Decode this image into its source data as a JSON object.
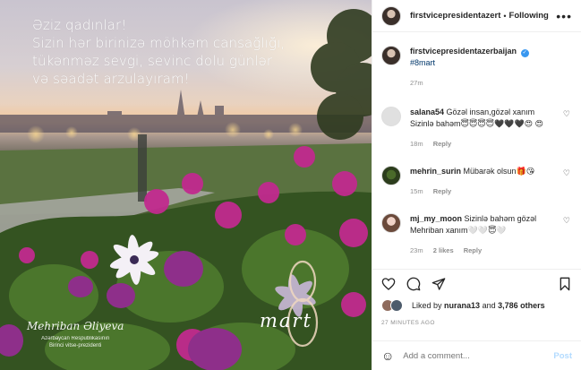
{
  "image": {
    "greeting_lines": [
      "Əziz qadınlar!",
      "Sizin hər birinizə möhkəm cansağlığı,",
      "tükənməz sevgi, sevinc dolu günlər",
      "və səadət arzulayıram!"
    ],
    "signature_name": "Mehriban Əliyeva",
    "signature_title_1": "Azərbaycan Respublikasının",
    "signature_title_2": "Birinci vitse-prezidenti",
    "logo_text": "mart"
  },
  "header": {
    "username": "firstvicepresidentazert",
    "separator": "•",
    "follow_label": "Following",
    "more": "•••"
  },
  "caption": {
    "username": "firstvicepresidentazerbaijan",
    "verified": "✓",
    "hashtag": "#8mart",
    "time": "27m"
  },
  "comments": [
    {
      "username": "salana54",
      "text": "Gözəl insan,gözəl xanım Sizinlə bahəm😇😇😇😇🖤🖤🖤😍 😍",
      "time": "18m",
      "likes": "",
      "reply": "Reply"
    },
    {
      "username": "mehrin_surin",
      "text": "Mübarək olsun🎁😘",
      "time": "15m",
      "likes": "",
      "reply": "Reply"
    },
    {
      "username": "mj_my_moon",
      "text": "Sizinlə bahəm gözəl Mehriban xanım🤍🤍😇🤍",
      "time": "23m",
      "likes": "2 likes",
      "reply": "Reply"
    }
  ],
  "likes": {
    "prefix": "Liked by",
    "user": "nurana13",
    "middle": "and",
    "count": "3,786 others"
  },
  "time_ago": "27 MINUTES AGO",
  "add_comment": {
    "placeholder": "Add a comment...",
    "post_label": "Post"
  },
  "colors": {
    "accent": "#3897f0",
    "post_disabled": "#b3dbff",
    "meta_grey": "#8e8e8e"
  }
}
